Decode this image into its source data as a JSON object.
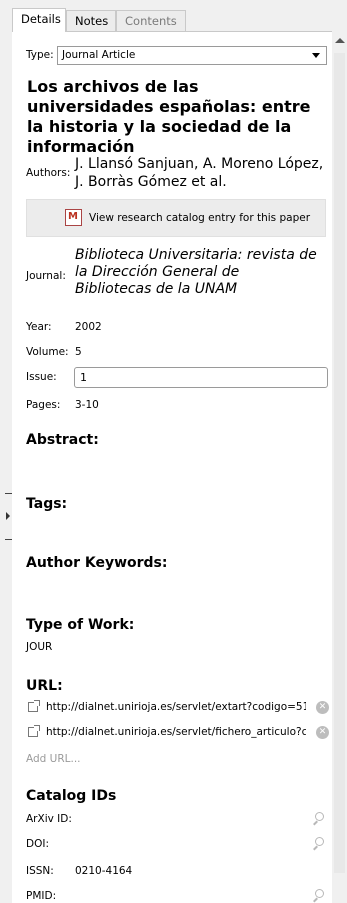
{
  "tabs": [
    {
      "label": "Details",
      "state": "active"
    },
    {
      "label": "Notes",
      "state": "normal"
    },
    {
      "label": "Contents",
      "state": "disabled"
    }
  ],
  "type": {
    "label": "Type:",
    "value": "Journal Article"
  },
  "title": "Los archivos de las universidades españolas: entre la historia y la sociedad de la información",
  "authors": {
    "label": "Authors:",
    "value": "J. Llansó Sanjuan, A. Moreno López, J. Borràs Gómez et al."
  },
  "catalog_button": {
    "label": "View research catalog entry for this paper",
    "icon": "mendeley-icon"
  },
  "journal": {
    "label": "Journal:",
    "value": "Biblioteca Universitaria: revista de la Dirección General de Bibliotecas de la UNAM"
  },
  "year": {
    "label": "Year:",
    "value": "2002"
  },
  "volume": {
    "label": "Volume:",
    "value": "5"
  },
  "issue": {
    "label": "Issue:",
    "value": "1"
  },
  "pages": {
    "label": "Pages:",
    "value": "3-10"
  },
  "sections": {
    "abstract": "Abstract:",
    "tags": "Tags:",
    "author_keywords": "Author Keywords:",
    "type_of_work": "Type of Work:",
    "url": "URL:",
    "catalog_ids": "Catalog IDs"
  },
  "type_of_work_value": "JOUR",
  "urls": [
    "http://dialnet.unirioja.es/servlet/extart?codigo=51...",
    "http://dialnet.unirioja.es/servlet/fichero_articulo?co..."
  ],
  "add_url": "Add URL...",
  "catalog_ids": [
    {
      "label": "ArXiv ID:",
      "value": ""
    },
    {
      "label": "DOI:",
      "value": ""
    },
    {
      "label": "ISSN:",
      "value": "0210-4164"
    },
    {
      "label": "PMID:",
      "value": ""
    }
  ]
}
